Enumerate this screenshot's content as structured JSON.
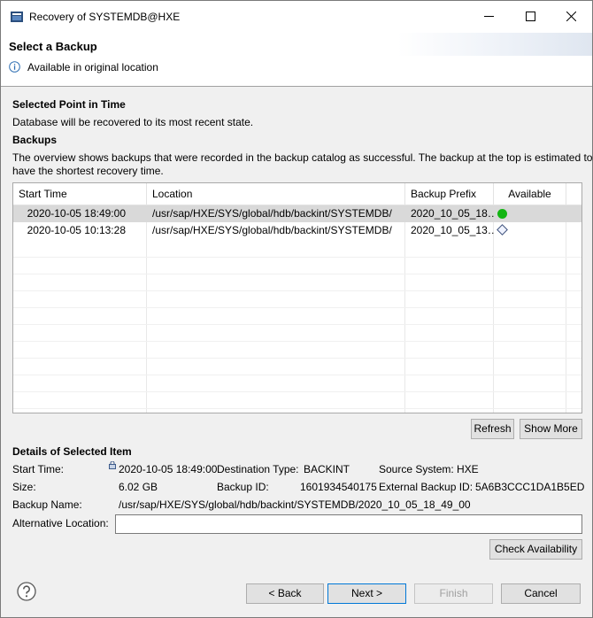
{
  "window": {
    "title": "Recovery of SYSTEMDB@HXE"
  },
  "header": {
    "title": "Select a Backup",
    "message": "Available in original location"
  },
  "point_in_time": {
    "heading": "Selected Point in Time",
    "text": "Database will be recovered to its most recent state."
  },
  "backups": {
    "heading": "Backups",
    "description_line1": "The overview shows backups that were recorded in the backup catalog as successful. The backup at the top is estimated to",
    "description_line2": "have the shortest recovery time.",
    "columns": [
      "Start Time",
      "Location",
      "Backup Prefix",
      "Available"
    ],
    "rows": [
      {
        "start_time": "2020-10-05 18:49:00",
        "location": "/usr/sap/HXE/SYS/global/hdb/backint/SYSTEMDB/",
        "prefix": "2020_10_05_18…",
        "available": "green-dot-icon"
      },
      {
        "start_time": "2020-10-05 10:13:28",
        "location": "/usr/sap/HXE/SYS/global/hdb/backint/SYSTEMDB/",
        "prefix": "2020_10_05_13…",
        "available": "diamond-icon"
      }
    ],
    "refresh_label": "Refresh",
    "show_more_label": "Show More"
  },
  "details": {
    "heading": "Details of Selected Item",
    "start_time_label": "Start Time:",
    "start_time_value": "2020-10-05 18:49:00",
    "destination_type_label": "Destination Type:",
    "destination_type_value": "BACKINT",
    "source_system_label": "Source System:",
    "source_system_value": "HXE",
    "size_label": "Size:",
    "size_value": "6.02 GB",
    "backup_id_label": "Backup ID:",
    "backup_id_value": "1601934540175",
    "external_backup_id_label": "External Backup ID:",
    "external_backup_id_value": "5A6B3CCC1DA1B5ED",
    "backup_name_label": "Backup Name:",
    "backup_name_value": "/usr/sap/HXE/SYS/global/hdb/backint/SYSTEMDB/2020_10_05_18_49_00",
    "alt_location_label": "Alternative Location:",
    "alt_location_value": "",
    "check_availability_label": "Check Availability"
  },
  "footer": {
    "back_label": "< Back",
    "next_label": "Next >",
    "finish_label": "Finish",
    "cancel_label": "Cancel"
  },
  "colors": {
    "available_green": "#13b513",
    "selected_row": "#d9d9d9",
    "primary_border": "#0078d7"
  }
}
